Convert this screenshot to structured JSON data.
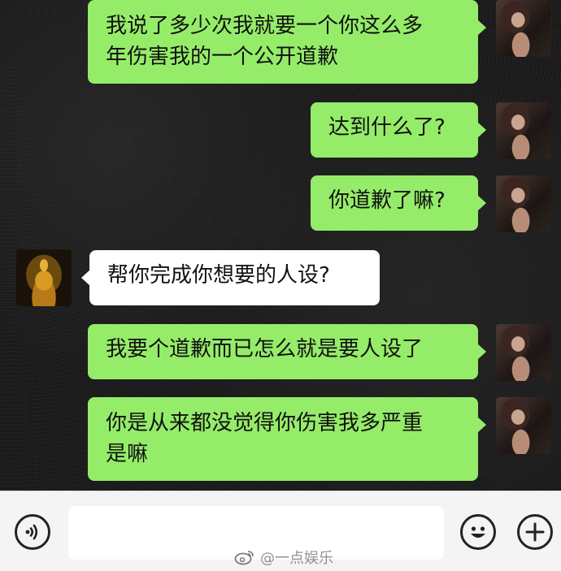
{
  "messages": [
    {
      "side": "right",
      "text": "我说了多少次我就要一个你这么多\n年伤害我的一个公开道歉"
    },
    {
      "side": "right",
      "text": "达到什么了?"
    },
    {
      "side": "right",
      "text": "你道歉了嘛?"
    },
    {
      "side": "left",
      "text": "帮你完成你想要的人设?"
    },
    {
      "side": "right",
      "text": "我要个道歉而已怎么就是要人设了"
    },
    {
      "side": "right",
      "text": "你是从来都没觉得你伤害我多严重\n是嘛"
    }
  ],
  "input_bar": {
    "placeholder": "",
    "voice_icon": "voice-icon",
    "emoji_icon": "emoji-icon",
    "plus_icon": "plus-icon"
  },
  "watermark": {
    "text": "@一点娱乐",
    "icon": "weibo-icon"
  },
  "colors": {
    "sent_bubble": "#95ec69",
    "received_bubble": "#ffffff",
    "input_bar_bg": "#f4f4f4"
  }
}
